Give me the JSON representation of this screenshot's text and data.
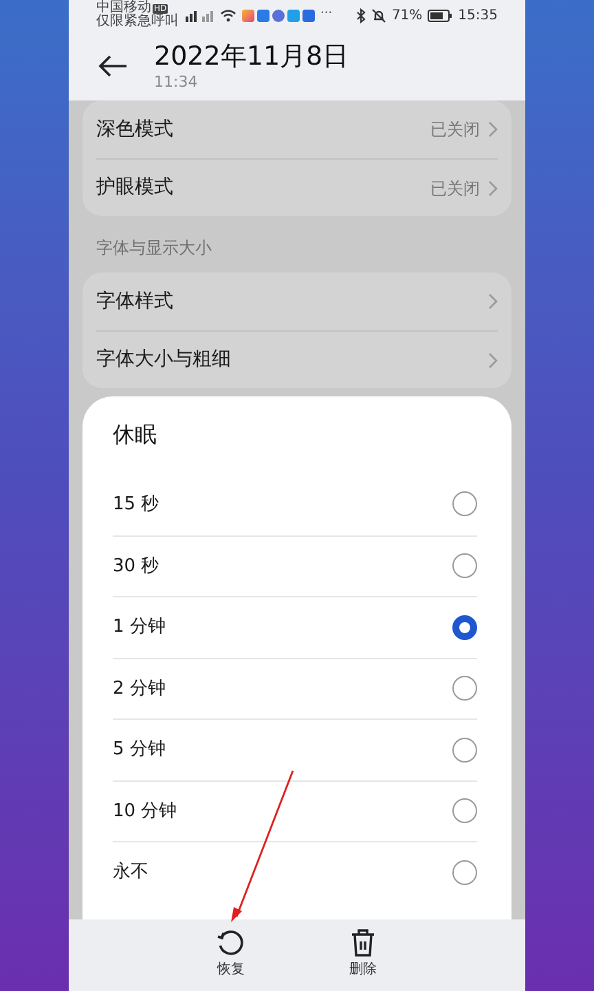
{
  "status_bar": {
    "carrier": "中国移动",
    "carrier_badge": "HD",
    "carrier_note": "仅限紧急呼叫",
    "more": "···",
    "battery": "71%",
    "time": "15:35"
  },
  "header": {
    "title": "2022年11月8日",
    "subtitle": "11:34"
  },
  "settings_cards": [
    {
      "rows": [
        {
          "label": "深色模式",
          "value": "已关闭"
        },
        {
          "label": "护眼模式",
          "value": "已关闭"
        }
      ]
    },
    {
      "section_label": "字体与显示大小",
      "rows": [
        {
          "label": "字体样式"
        },
        {
          "label": "字体大小与粗细"
        }
      ]
    }
  ],
  "dialog": {
    "title": "休眠",
    "options": [
      {
        "label": "15 秒",
        "selected": false
      },
      {
        "label": "30 秒",
        "selected": false
      },
      {
        "label": "1 分钟",
        "selected": true
      },
      {
        "label": "2 分钟",
        "selected": false
      },
      {
        "label": "5 分钟",
        "selected": false
      },
      {
        "label": "10 分钟",
        "selected": false
      },
      {
        "label": "永不",
        "selected": false
      }
    ]
  },
  "toolbar": [
    {
      "kind": "restore",
      "label": "恢复"
    },
    {
      "kind": "delete",
      "label": "删除"
    }
  ]
}
